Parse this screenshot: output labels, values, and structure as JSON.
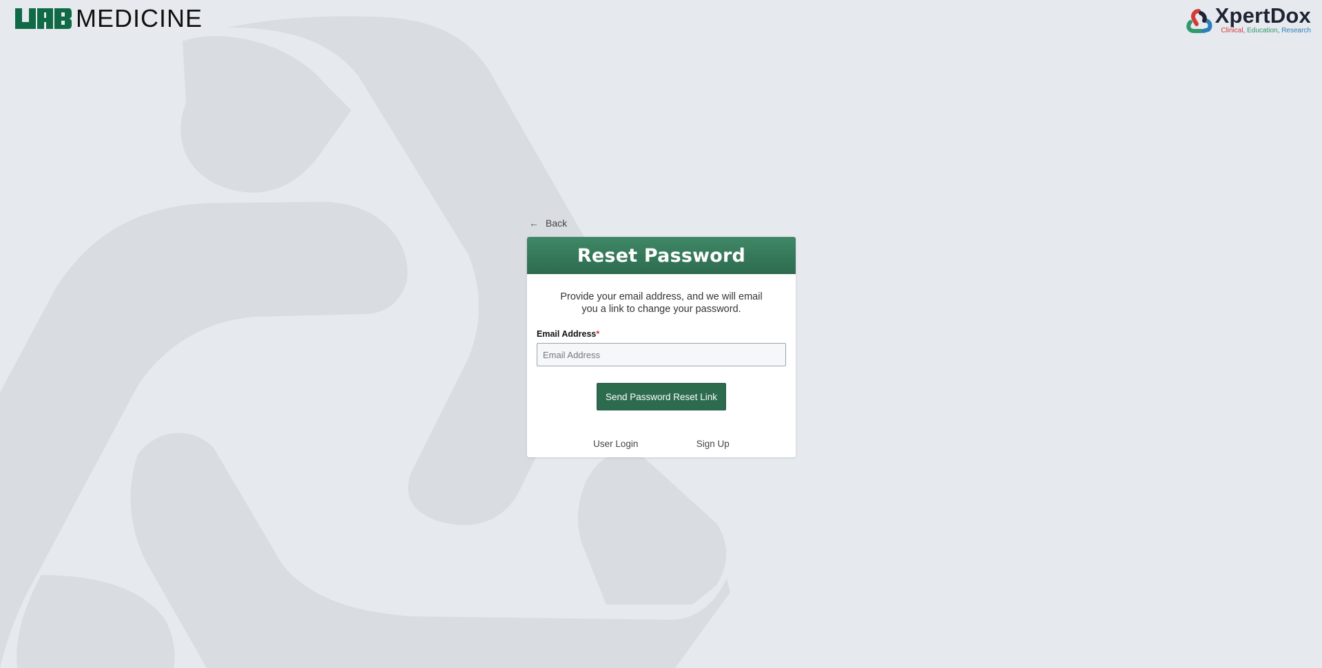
{
  "brand_left": {
    "mark_text": "UAB",
    "word": "MEDICINE",
    "color": "#0f6a45"
  },
  "brand_right": {
    "name": "XpertDox",
    "tag_clinical": "Clinical",
    "tag_education": "Education",
    "tag_research": "Research",
    "tag_sep": ", "
  },
  "nav": {
    "back_label": "Back",
    "back_icon": "arrow-left-icon"
  },
  "card": {
    "title": "Reset Password",
    "description": "Provide your email address, and we will email you a link to change your password.",
    "email_label": "Email Address",
    "required_mark": "*",
    "email_placeholder": "Email Address",
    "email_value": "",
    "submit_label": "Send Password Reset Link",
    "login_link": "User Login",
    "signup_link": "Sign Up"
  },
  "colors": {
    "accent": "#2d6b4f",
    "background": "#e6e9ee",
    "shape": "#d9dce1",
    "required": "#dd3333"
  }
}
